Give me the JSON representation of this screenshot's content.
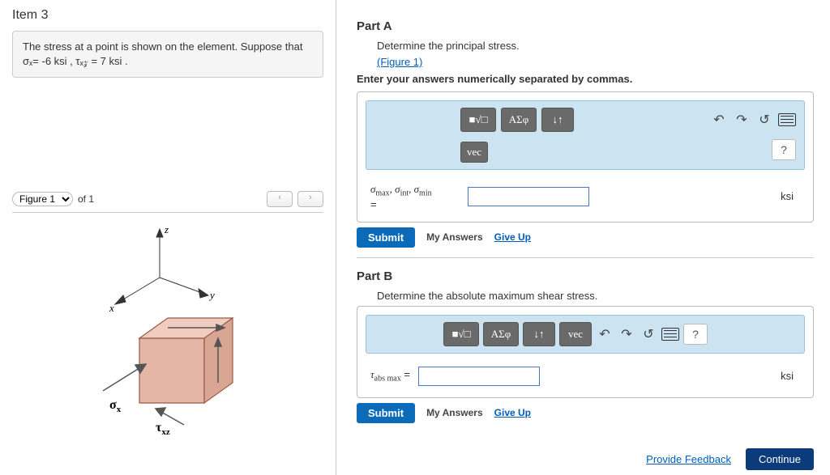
{
  "item_title": "Item 3",
  "problem_text": "The stress at a point is shown on the element. Suppose that σₓ= -6 ksi , τₓ𝓏 = 7 ksi .",
  "figure": {
    "select_label": "Figure 1",
    "of_label": "of 1",
    "axis_x": "x",
    "axis_y": "y",
    "axis_z": "z",
    "sigma_x": "σ",
    "sigma_x_sub": "x",
    "tau_xz": "τ",
    "tau_xz_sub": "xz"
  },
  "partA": {
    "title": "Part A",
    "prompt": "Determine the principal stress.",
    "figure_link": "(Figure 1)",
    "instr": "Enter your answers numerically separated by commas.",
    "var_html": "σmax, σint, σmin",
    "eq": "=",
    "unit": "ksi"
  },
  "partB": {
    "title": "Part B",
    "prompt": "Determine the absolute maximum shear stress.",
    "var_html": "τabs max",
    "eq": " = ",
    "unit": "ksi"
  },
  "tools": {
    "template": "■√□",
    "greek": "ΑΣφ",
    "arrows": "↓↑",
    "vec": "vec",
    "undo": "↶",
    "redo": "↷",
    "reset": "↺",
    "help": "?"
  },
  "actions": {
    "submit": "Submit",
    "my_answers": "My Answers",
    "give_up": "Give Up"
  },
  "footer": {
    "feedback": "Provide Feedback",
    "continue": "Continue"
  }
}
